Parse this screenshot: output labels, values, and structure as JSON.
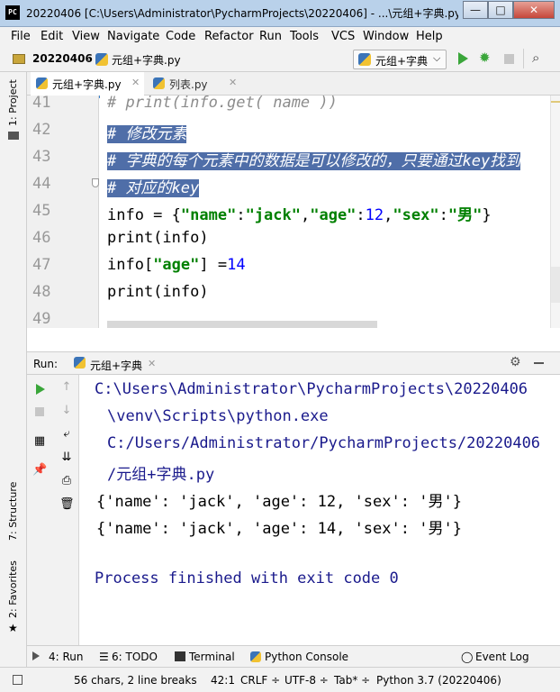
{
  "window": {
    "title": "20220406 [C:\\Users\\Administrator\\PycharmProjects\\20220406] - ...\\元组+字典.py [...",
    "logo": "PC",
    "minimize": "—",
    "maximize": "□",
    "close": "✕"
  },
  "menu": [
    "File",
    "Edit",
    "View",
    "Navigate",
    "Code",
    "Refactor",
    "Run",
    "Tools",
    "VCS",
    "Window",
    "Help"
  ],
  "navbar": {
    "project": "20220406",
    "file": "元组+字典.py",
    "run_config": "元组+字典"
  },
  "sidebar_left": {
    "project": "1: Project",
    "structure": "7: Structure",
    "favorites": "2: Favorites"
  },
  "tabs": [
    {
      "label": "元组+字典.py"
    },
    {
      "label": "列表.py"
    }
  ],
  "editor": {
    "line_numbers": [
      "41",
      "42",
      "43",
      "44",
      "45",
      "46",
      "47",
      "48",
      "49"
    ],
    "line41": "# print(info.get( name ))",
    "line42": "# 修改元素",
    "line43": "# 字典的每个元素中的数据是可以修改的，只要通过key找到",
    "line44": "# 对应的key",
    "line45": {
      "a": "info = {",
      "b": "\"name\"",
      "c": ":",
      "d": "\"jack\"",
      "e": ",",
      "f": "\"age\"",
      "g": ":",
      "h": "12",
      "i": ",",
      "j": "\"sex\"",
      "k": ":",
      "l": "\"男\"",
      "m": "}"
    },
    "line46": "print(info)",
    "line47": {
      "a": "info[",
      "b": "\"age\"",
      "c": "] =",
      "d": "14"
    },
    "line48": "print(info)"
  },
  "run_panel": {
    "label": "Run:",
    "tab": "元组+字典",
    "output": [
      "C:\\Users\\Administrator\\PycharmProjects\\20220406",
      "\\venv\\Scripts\\python.exe",
      "C:/Users/Administrator/PycharmProjects/20220406",
      "/元组+字典.py",
      "{'name': 'jack', 'age': 12, 'sex': '男'}",
      "{'name': 'jack', 'age': 14, 'sex': '男'}",
      "Process finished with exit code 0"
    ]
  },
  "bottom_tools": {
    "run": "4: Run",
    "todo": "6: TODO",
    "terminal": "Terminal",
    "python_console": "Python Console",
    "event_log": "Event Log"
  },
  "status": {
    "chars": "56 chars, 2 line breaks",
    "position": "42:1",
    "line_sep": "CRLF ÷",
    "encoding": "UTF-8 ÷",
    "indent": "Tab* ÷",
    "interpreter": "Python 3.7 (20220406)"
  }
}
